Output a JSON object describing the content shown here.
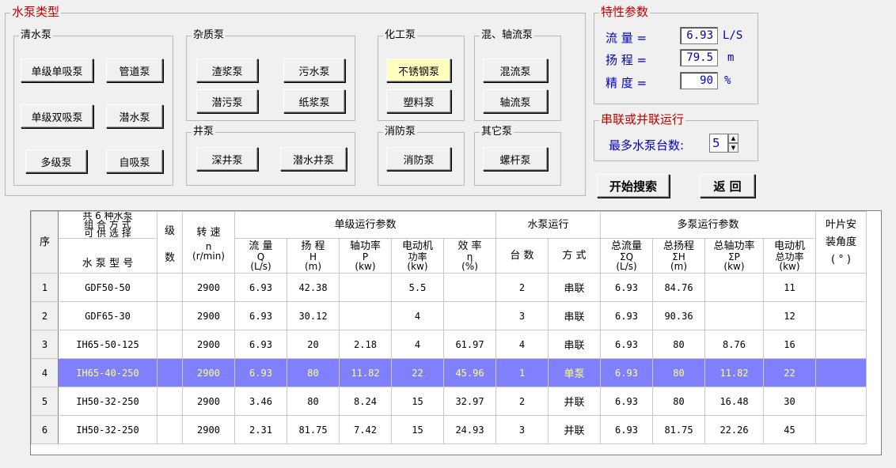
{
  "pump_type": {
    "title": "水泵类型",
    "clear": {
      "title": "清水泵",
      "buttons": [
        "单级单吸泵",
        "管道泵",
        "单级双吸泵",
        "潜水泵",
        "多级泵",
        "自吸泵"
      ]
    },
    "impurity": {
      "title": "杂质泵",
      "buttons": [
        "渣浆泵",
        "污水泵",
        "潜污泵",
        "纸浆泵"
      ]
    },
    "well": {
      "title": "井泵",
      "buttons": [
        "深井泵",
        "潜水井泵"
      ]
    },
    "chemical": {
      "title": "化工泵",
      "buttons": [
        "不锈钢泵",
        "塑料泵"
      ],
      "selected": "不锈钢泵"
    },
    "mixed": {
      "title": "混、轴流泵",
      "buttons": [
        "混流泵",
        "轴流泵"
      ]
    },
    "fire": {
      "title": "消防泵",
      "buttons": [
        "消防泵"
      ]
    },
    "other": {
      "title": "其它泵",
      "buttons": [
        "螺杆泵"
      ]
    }
  },
  "params": {
    "title": "特性参数",
    "flow": {
      "label": "流  量 =",
      "value": "6.93",
      "unit": "L/S"
    },
    "head": {
      "label": "扬  程 =",
      "value": "79.5",
      "unit": "m"
    },
    "precision": {
      "label": "精  度 =",
      "value": "90",
      "unit": "%"
    }
  },
  "series": {
    "title": "串联或并联运行",
    "label": "最多水泵台数:",
    "value": "5"
  },
  "actions": {
    "search": "开始搜索",
    "back": "返  回"
  },
  "grid": {
    "h_seq": [
      "序",
      "号"
    ],
    "h_combo": [
      "共 6 种水泵",
      "组 合 方 式",
      "可 供 选 择"
    ],
    "h_model": "水 泵 型 号",
    "h_stage": [
      "级",
      "数"
    ],
    "h_speed": [
      "转  速",
      "n",
      "(r/min)"
    ],
    "h_single": "单级运行参数",
    "h_single_cols": [
      [
        "流  量",
        "Q",
        "(L/s)"
      ],
      [
        "扬  程",
        "H",
        "(m)"
      ],
      [
        "轴功率",
        "P",
        "(kw)"
      ],
      [
        "电动机",
        "功率",
        "(kw)"
      ],
      [
        "效  率",
        "η",
        "(%)"
      ]
    ],
    "h_run": "水泵运行",
    "h_run_cols": [
      "台  数",
      "方  式"
    ],
    "h_multi": "多泵运行参数",
    "h_multi_cols": [
      [
        "总流量",
        "ΣQ",
        "(L/s)"
      ],
      [
        "总扬程",
        "ΣH",
        "(m)"
      ],
      [
        "总轴功率",
        "ΣP",
        "(kw)"
      ],
      [
        "电动机",
        "总功率",
        "(kw)"
      ]
    ],
    "h_blade": [
      "叶片安",
      "装角度",
      "( ° )"
    ],
    "highlight_row": 3,
    "rows": [
      {
        "n": "1",
        "model": "GDF50-50",
        "stage": "",
        "speed": "2900",
        "q": "6.93",
        "h": "42.38",
        "p": "",
        "motor": "5.5",
        "eff": "",
        "cnt": "2",
        "mode": "串联",
        "sq": "6.93",
        "sh": "84.76",
        "sp": "",
        "tp": "11",
        "blade": ""
      },
      {
        "n": "2",
        "model": "GDF65-30",
        "stage": "",
        "speed": "2900",
        "q": "6.93",
        "h": "30.12",
        "p": "",
        "motor": "4",
        "eff": "",
        "cnt": "3",
        "mode": "串联",
        "sq": "6.93",
        "sh": "90.36",
        "sp": "",
        "tp": "12",
        "blade": ""
      },
      {
        "n": "3",
        "model": "IH65-50-125",
        "stage": "",
        "speed": "2900",
        "q": "6.93",
        "h": "20",
        "p": "2.18",
        "motor": "4",
        "eff": "61.97",
        "cnt": "4",
        "mode": "串联",
        "sq": "6.93",
        "sh": "80",
        "sp": "8.76",
        "tp": "16",
        "blade": ""
      },
      {
        "n": "4",
        "model": "IH65-40-250",
        "stage": "",
        "speed": "2900",
        "q": "6.93",
        "h": "80",
        "p": "11.82",
        "motor": "22",
        "eff": "45.96",
        "cnt": "1",
        "mode": "单泵",
        "sq": "6.93",
        "sh": "80",
        "sp": "11.82",
        "tp": "22",
        "blade": ""
      },
      {
        "n": "5",
        "model": "IH50-32-250",
        "stage": "",
        "speed": "2900",
        "q": "3.46",
        "h": "80",
        "p": "8.24",
        "motor": "15",
        "eff": "32.97",
        "cnt": "2",
        "mode": "并联",
        "sq": "6.93",
        "sh": "80",
        "sp": "16.48",
        "tp": "30",
        "blade": ""
      },
      {
        "n": "6",
        "model": "IH50-32-250",
        "stage": "",
        "speed": "2900",
        "q": "2.31",
        "h": "81.75",
        "p": "7.42",
        "motor": "15",
        "eff": "24.93",
        "cnt": "3",
        "mode": "并联",
        "sq": "6.93",
        "sh": "81.75",
        "sp": "22.26",
        "tp": "45",
        "blade": ""
      }
    ]
  }
}
